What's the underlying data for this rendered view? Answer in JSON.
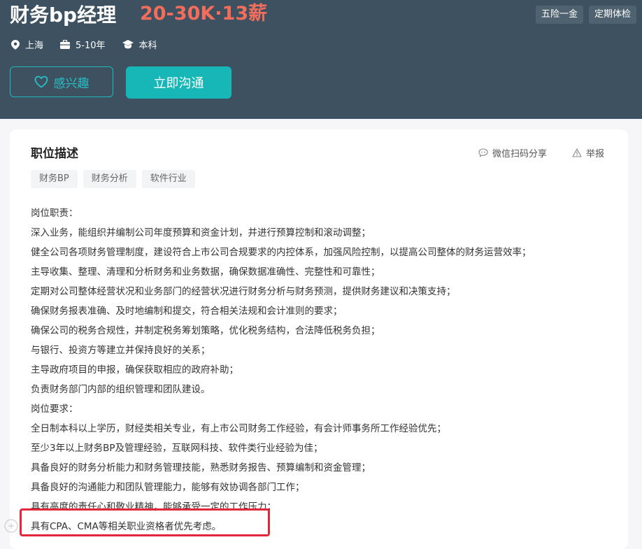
{
  "job": {
    "title": "财务bp经理",
    "salary": "20-30K·13薪",
    "welfare": [
      "五险一金",
      "定期体检"
    ],
    "meta": {
      "location": "上海",
      "experience": "5-10年",
      "education": "本科"
    },
    "actions": {
      "interest_label": "感兴趣",
      "chat_label": "立即沟通"
    }
  },
  "description": {
    "title": "职位描述",
    "share_label": "微信扫码分享",
    "report_label": "举报",
    "tags": [
      "财务BP",
      "财务分析",
      "软件行业"
    ],
    "lines": [
      "岗位职责：",
      "深入业务，能组织并编制公司年度预算和资金计划，并进行预算控制和滚动调整；",
      "健全公司各项财务管理制度，建设符合上市公司合规要求的内控体系，加强风险控制，以提高公司整体的财务运营效率；",
      "主导收集、整理、清理和分析财务和业务数据，确保数据准确性、完整性和可靠性；",
      "定期对公司整体经营状况和业务部门的经营状况进行财务分析与财务预测，提供财务建议和决策支持；",
      " 确保财务报表准确、及时地编制和提交，符合相关法规和会计准则的要求；",
      " 确保公司的税务合规性，并制定税务筹划策略，优化税务结构，合法降低税务负担；",
      "与银行、投资方等建立并保持良好的关系；",
      "主导政府项目的申报，确保获取相应的政府补助；",
      "负责财务部门内部的组织管理和团队建设。",
      "岗位要求：",
      "全日制本科以上学历，财经类相关专业，有上市公司财务工作经验，有会计师事务所工作经验优先；",
      "至少3年以上财务BP及管理经验，互联网科技、软件类行业经验为佳；",
      "具备良好的财务分析能力和财务管理技能，熟悉财务报告、预算编制和资金管理；",
      "具备良好的沟通能力和团队管理能力，能够有效协调各部门工作；",
      "具有高度的责任心和敬业精神，能够承受一定的工作压力；",
      "具有CPA、CMA等相关职业资格者优先考虑。"
    ]
  },
  "icons": {
    "location": "location-pin-icon",
    "experience": "briefcase-icon",
    "education": "graduation-cap-icon",
    "interest": "heart-icon",
    "share": "chat-bubble-icon",
    "report": "warning-icon"
  },
  "colors": {
    "header_bg": "#3d5160",
    "salary": "#f26d5b",
    "accent": "#17b7b8",
    "highlight": "#e0283a"
  }
}
